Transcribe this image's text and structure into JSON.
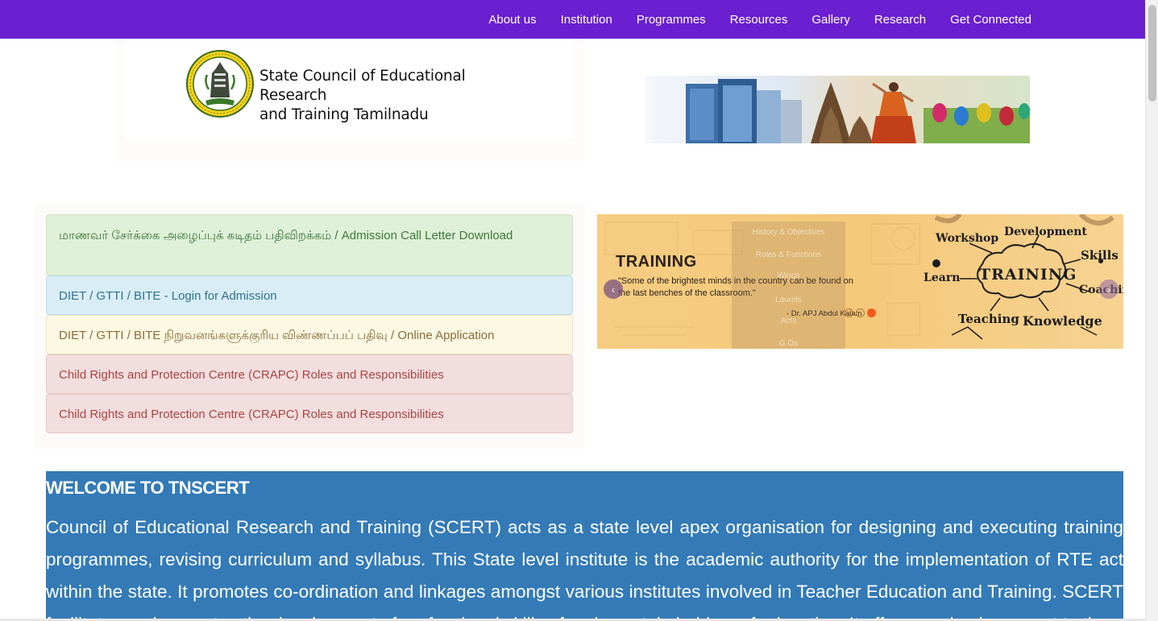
{
  "nav": {
    "items": [
      "About us",
      "Institution",
      "Programmes",
      "Resources",
      "Gallery",
      "Research",
      "Get Connected"
    ]
  },
  "header": {
    "org_name_line1": "State Council of Educational Research",
    "org_name_line2": "and Training Tamilnadu",
    "emblem_icon": "tamilnadu-emblem-icon",
    "banner_icon": "tamilnadu-culture-banner-image"
  },
  "notices": [
    {
      "label": "மாணவர் சேர்க்கை அழைப்புக் கடிதம் பதிவிறக்கம் / Admission Call Letter Download",
      "color": "#dff0d8"
    },
    {
      "label": "DIET / GTTI / BITE - Login for Admission",
      "color": "#d9edf7"
    },
    {
      "label": "DIET / GTTI / BITE நிறுவனங்களுக்குரிய விண்ணப்பப் பதிவு / Online Application",
      "color": "#fcf8e3"
    },
    {
      "label": "Child Rights and Protection Centre (CRAPC) Roles and Responsibilities",
      "color": "#f2dede"
    },
    {
      "label": "Child Rights and Protection Centre (CRAPC) Roles and Responsibilities",
      "color": "#f2dede"
    }
  ],
  "carousel": {
    "slide_title": "TRAINING",
    "quote": "\"Some of the brightest minds in the country can be found on the last benches of the classroom.\"",
    "author": "- Dr. APJ Abdul Kalam",
    "cloud_center": "TRAINING",
    "cloud_words": [
      "Workshop",
      "Development",
      "Skills",
      "Learn",
      "Coaching",
      "Teaching",
      "Knowledge"
    ],
    "overlay_menu": [
      "History & Objectives",
      "Roles & Functions",
      "Wings",
      "Laurels",
      "Acts",
      "G.Os"
    ],
    "total_slides": 3,
    "active_slide": 3,
    "prev_icon": "chevron-left-icon",
    "next_icon": "chevron-right-icon"
  },
  "welcome": {
    "heading": "WELCOME TO TNSCERT",
    "body": "Council of Educational Research and Training (SCERT) acts as a state level apex organisation for designing and executing training programmes, revising curriculum and syllabus. This State level institute is the academic authority for the implementation of RTE act within the state. It promotes co-ordination and linkages amongst various institutes involved in Teacher Education and Training. SCERT facilitates and promotes the development of professional skills of various stakeholders of education. It offers academic support to the"
  },
  "colors": {
    "nav_bg": "#6a1fd0",
    "welcome_bg": "#337ab7",
    "active_dot": "#f05a1e"
  }
}
